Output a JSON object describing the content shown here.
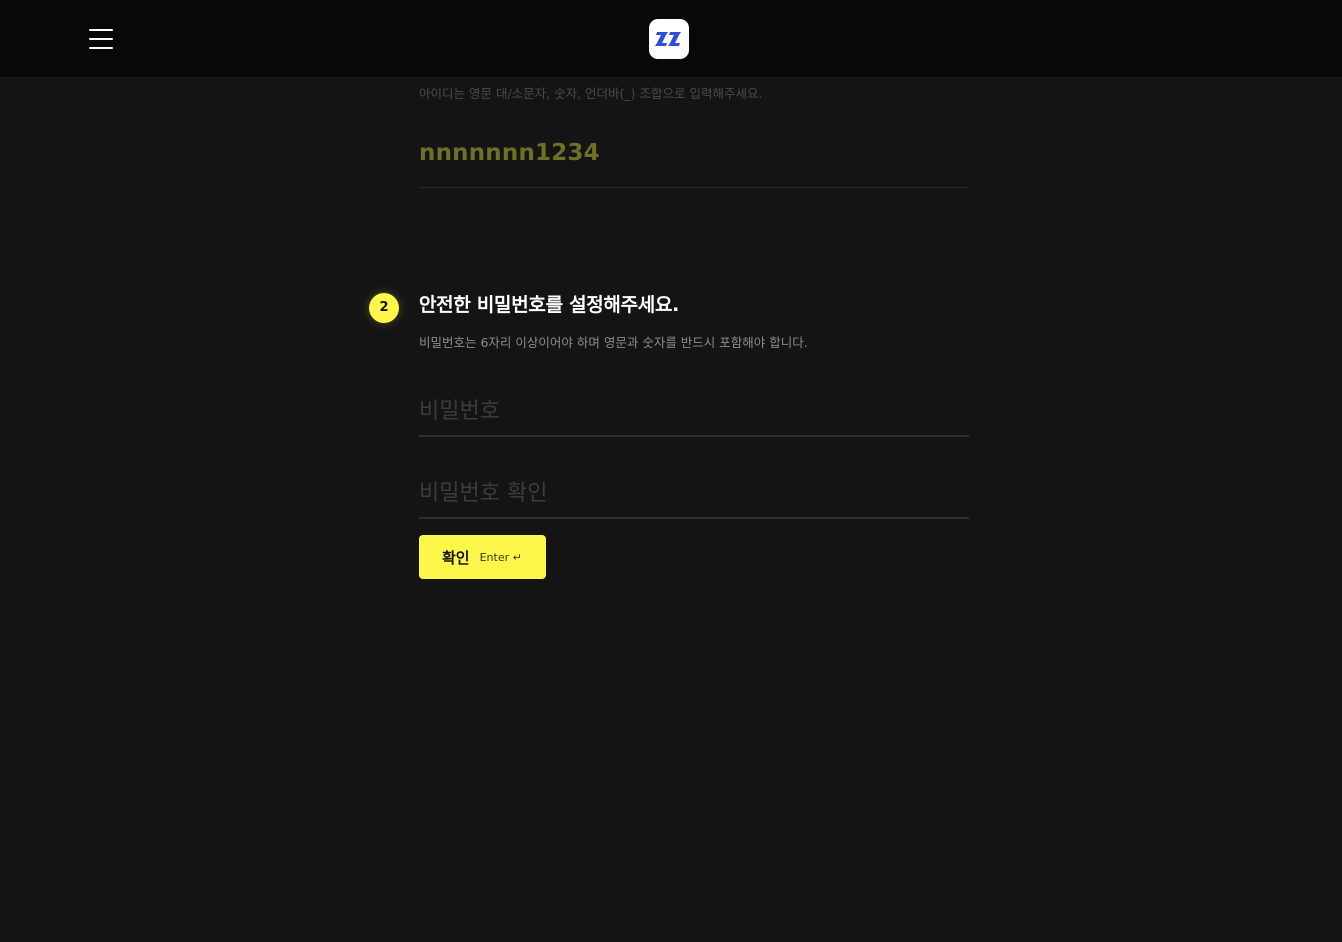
{
  "header": {
    "menu_icon": "hamburger-menu-icon",
    "logo_icon": "zz-logo-icon",
    "brand_color": "#2c4fdc"
  },
  "step1": {
    "hint": "아이디는 영문 대/소문자, 숫자, 언더바(_) 조합으로 입력해주세요.",
    "id_value": "nnnnnnn1234"
  },
  "step2": {
    "number": "2",
    "title": "안전한 비밀번호를 설정해주세요.",
    "description": "비밀번호는 6자리 이상이어야 하며 영문과 숫자를 반드시 포함해야 합니다.",
    "password_placeholder": "비밀번호",
    "password_value": "",
    "confirm_placeholder": "비밀번호 확인",
    "confirm_value": ""
  },
  "actions": {
    "confirm_label": "확인",
    "enter_hint": "Enter ↵",
    "accent_color": "#fdf64b"
  }
}
